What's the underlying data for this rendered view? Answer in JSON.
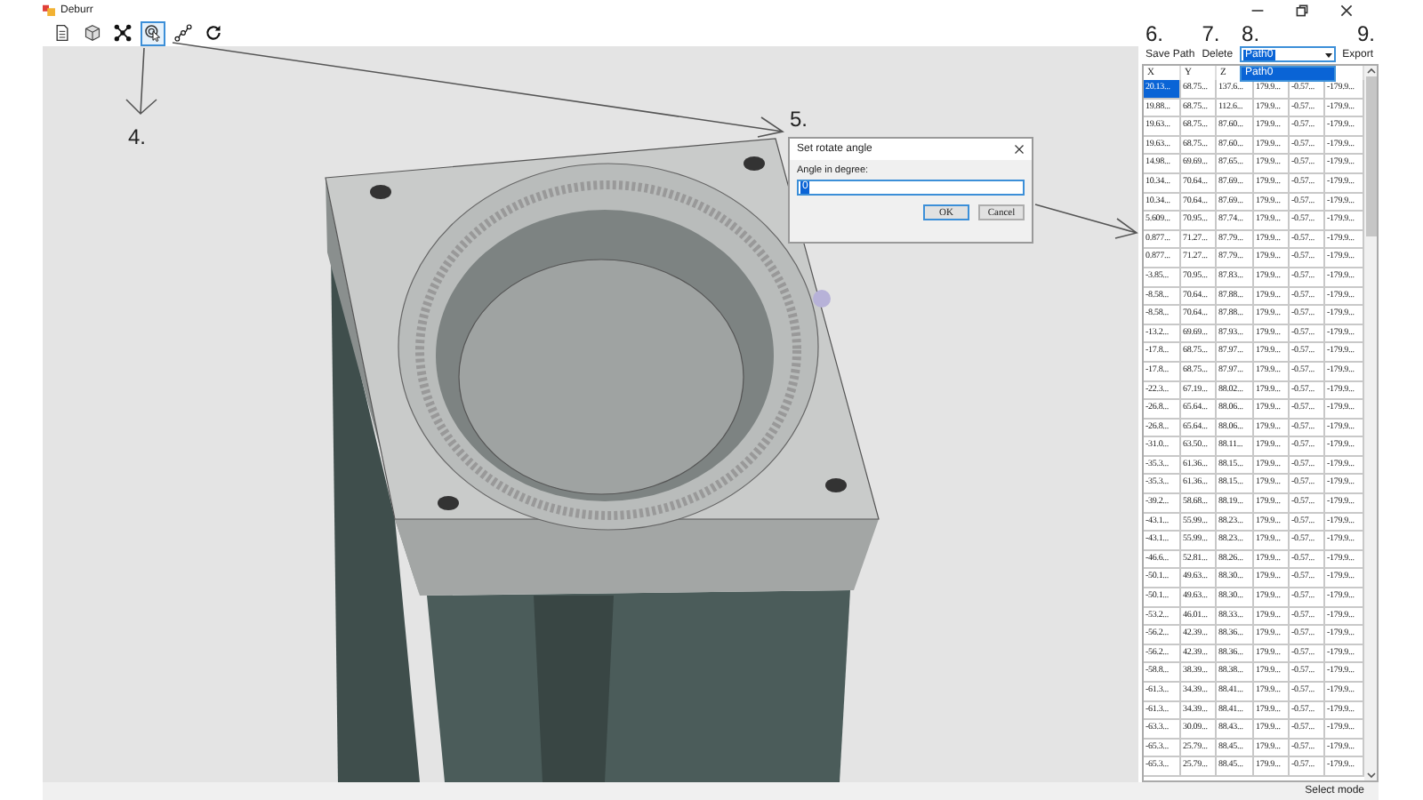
{
  "window": {
    "title": "Deburr"
  },
  "toolbar": {
    "callout": "4.",
    "tools": [
      {
        "kind": "document",
        "selected": false
      },
      {
        "kind": "cube",
        "selected": false
      },
      {
        "kind": "network",
        "selected": false
      },
      {
        "kind": "pointer",
        "selected": true
      },
      {
        "kind": "path",
        "selected": false
      },
      {
        "kind": "refresh",
        "selected": false
      }
    ]
  },
  "dialog": {
    "callout": "5.",
    "title": "Set rotate angle",
    "label": "Angle in degree:",
    "value": "0",
    "buttons": [
      "OK",
      "Cancel"
    ]
  },
  "path_panel": {
    "save_button": {
      "label": "Save Path",
      "callout": "6."
    },
    "delete_button": {
      "label": "Delete",
      "callout": "7."
    },
    "path_select": {
      "value": "Path0",
      "callout": "8.",
      "expanded": true,
      "options": [
        {
          "label": "Path0",
          "selected": true
        }
      ]
    },
    "export_button": {
      "label": "Export",
      "callout": "9."
    }
  },
  "table": {
    "columns": [
      "X",
      "Y",
      "Z"
    ],
    "rows": [
      {
        "cells": [
          "20.13...",
          "68.75...",
          "137.6...",
          "179.9...",
          "-0.57...",
          "-179.9..."
        ],
        "selected": true
      },
      {
        "cells": [
          "19.88...",
          "68.75...",
          "112.6...",
          "179.9...",
          "-0.57...",
          "-179.9..."
        ],
        "selected": false
      },
      {
        "cells": [
          "19.63...",
          "68.75...",
          "87.60...",
          "179.9...",
          "-0.57...",
          "-179.9..."
        ],
        "selected": false
      },
      {
        "cells": [
          "19.63...",
          "68.75...",
          "87.60...",
          "179.9...",
          "-0.57...",
          "-179.9..."
        ],
        "selected": false
      },
      {
        "cells": [
          "14.98...",
          "69.69...",
          "87.65...",
          "179.9...",
          "-0.57...",
          "-179.9..."
        ],
        "selected": false
      },
      {
        "cells": [
          "10.34...",
          "70.64...",
          "87.69...",
          "179.9...",
          "-0.57...",
          "-179.9..."
        ],
        "selected": false
      },
      {
        "cells": [
          "10.34...",
          "70.64...",
          "87.69...",
          "179.9...",
          "-0.57...",
          "-179.9..."
        ],
        "selected": false
      },
      {
        "cells": [
          "5.609...",
          "70.95...",
          "87.74...",
          "179.9...",
          "-0.57...",
          "-179.9..."
        ],
        "selected": false
      },
      {
        "cells": [
          "0.877...",
          "71.27...",
          "87.79...",
          "179.9...",
          "-0.57...",
          "-179.9..."
        ],
        "selected": false
      },
      {
        "cells": [
          "0.877...",
          "71.27...",
          "87.79...",
          "179.9...",
          "-0.57...",
          "-179.9..."
        ],
        "selected": false
      },
      {
        "cells": [
          "-3.85...",
          "70.95...",
          "87.83...",
          "179.9...",
          "-0.57...",
          "-179.9..."
        ],
        "selected": false
      },
      {
        "cells": [
          "-8.58...",
          "70.64...",
          "87.88...",
          "179.9...",
          "-0.57...",
          "-179.9..."
        ],
        "selected": false
      },
      {
        "cells": [
          "-8.58...",
          "70.64...",
          "87.88...",
          "179.9...",
          "-0.57...",
          "-179.9..."
        ],
        "selected": false
      },
      {
        "cells": [
          "-13.2...",
          "69.69...",
          "87.93...",
          "179.9...",
          "-0.57...",
          "-179.9..."
        ],
        "selected": false
      },
      {
        "cells": [
          "-17.8...",
          "68.75...",
          "87.97...",
          "179.9...",
          "-0.57...",
          "-179.9..."
        ],
        "selected": false
      },
      {
        "cells": [
          "-17.8...",
          "68.75...",
          "87.97...",
          "179.9...",
          "-0.57...",
          "-179.9..."
        ],
        "selected": false
      },
      {
        "cells": [
          "-22.3...",
          "67.19...",
          "88.02...",
          "179.9...",
          "-0.57...",
          "-179.9..."
        ],
        "selected": false
      },
      {
        "cells": [
          "-26.8...",
          "65.64...",
          "88.06...",
          "179.9...",
          "-0.57...",
          "-179.9..."
        ],
        "selected": false
      },
      {
        "cells": [
          "-26.8...",
          "65.64...",
          "88.06...",
          "179.9...",
          "-0.57...",
          "-179.9..."
        ],
        "selected": false
      },
      {
        "cells": [
          "-31.0...",
          "63.50...",
          "88.11...",
          "179.9...",
          "-0.57...",
          "-179.9..."
        ],
        "selected": false
      },
      {
        "cells": [
          "-35.3...",
          "61.36...",
          "88.15...",
          "179.9...",
          "-0.57...",
          "-179.9..."
        ],
        "selected": false
      },
      {
        "cells": [
          "-35.3...",
          "61.36...",
          "88.15...",
          "179.9...",
          "-0.57...",
          "-179.9..."
        ],
        "selected": false
      },
      {
        "cells": [
          "-39.2...",
          "58.68...",
          "88.19...",
          "179.9...",
          "-0.57...",
          "-179.9..."
        ],
        "selected": false
      },
      {
        "cells": [
          "-43.1...",
          "55.99...",
          "88.23...",
          "179.9...",
          "-0.57...",
          "-179.9..."
        ],
        "selected": false
      },
      {
        "cells": [
          "-43.1...",
          "55.99...",
          "88.23...",
          "179.9...",
          "-0.57...",
          "-179.9..."
        ],
        "selected": false
      },
      {
        "cells": [
          "-46.6...",
          "52.81...",
          "88.26...",
          "179.9...",
          "-0.57...",
          "-179.9..."
        ],
        "selected": false
      },
      {
        "cells": [
          "-50.1...",
          "49.63...",
          "88.30...",
          "179.9...",
          "-0.57...",
          "-179.9..."
        ],
        "selected": false
      },
      {
        "cells": [
          "-50.1...",
          "49.63...",
          "88.30...",
          "179.9...",
          "-0.57...",
          "-179.9..."
        ],
        "selected": false
      },
      {
        "cells": [
          "-53.2...",
          "46.01...",
          "88.33...",
          "179.9...",
          "-0.57...",
          "-179.9..."
        ],
        "selected": false
      },
      {
        "cells": [
          "-56.2...",
          "42.39...",
          "88.36...",
          "179.9...",
          "-0.57...",
          "-179.9..."
        ],
        "selected": false
      },
      {
        "cells": [
          "-56.2...",
          "42.39...",
          "88.36...",
          "179.9...",
          "-0.57...",
          "-179.9..."
        ],
        "selected": false
      },
      {
        "cells": [
          "-58.8...",
          "38.39...",
          "88.38...",
          "179.9...",
          "-0.57...",
          "-179.9..."
        ],
        "selected": false
      },
      {
        "cells": [
          "-61.3...",
          "34.39...",
          "88.41...",
          "179.9...",
          "-0.57...",
          "-179.9..."
        ],
        "selected": false
      },
      {
        "cells": [
          "-61.3...",
          "34.39...",
          "88.41...",
          "179.9...",
          "-0.57...",
          "-179.9..."
        ],
        "selected": false
      },
      {
        "cells": [
          "-63.3...",
          "30.09...",
          "88.43...",
          "179.9...",
          "-0.57...",
          "-179.9..."
        ],
        "selected": false
      },
      {
        "cells": [
          "-65.3...",
          "25.79...",
          "88.45...",
          "179.9...",
          "-0.57...",
          "-179.9..."
        ],
        "selected": false
      },
      {
        "cells": [
          "-65.3...",
          "25.79...",
          "88.45...",
          "179.9...",
          "-0.57...",
          "-179.9..."
        ],
        "selected": false
      }
    ]
  },
  "status_bar": {
    "text": "Select mode"
  }
}
